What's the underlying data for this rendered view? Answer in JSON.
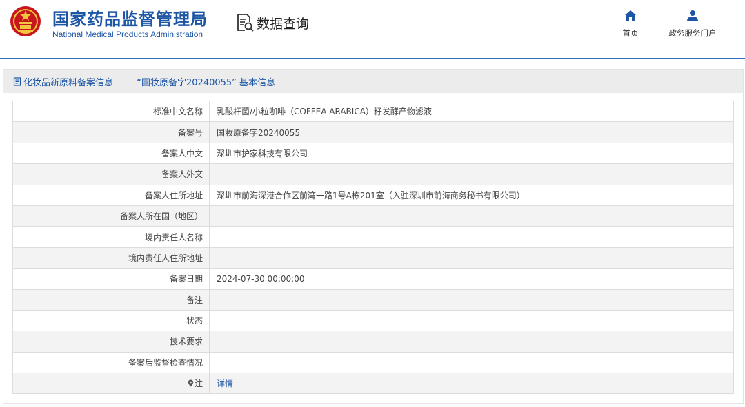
{
  "header": {
    "org_name_cn": "国家药品监督管理局",
    "org_name_en": "National Medical Products Administration",
    "section_title": "数据查询",
    "nav": [
      {
        "label": "首页",
        "icon": "home-icon"
      },
      {
        "label": "政务服务门户",
        "icon": "user-icon"
      }
    ]
  },
  "panel": {
    "title": "化妆品新原料备案信息 —— “国妆原备字20240055” 基本信息",
    "rows": [
      {
        "label": "标准中文名称",
        "value": "乳酸杆菌/小粒咖啡（COFFEA ARABICA）籽发酵产物滤液"
      },
      {
        "label": "备案号",
        "value": "国妆原备字20240055"
      },
      {
        "label": "备案人中文",
        "value": "深圳市护家科技有限公司"
      },
      {
        "label": "备案人外文",
        "value": ""
      },
      {
        "label": "备案人住所地址",
        "value": "深圳市前海深港合作区前湾一路1号A栋201室（入驻深圳市前海商务秘书有限公司）"
      },
      {
        "label": "备案人所在国（地区）",
        "value": ""
      },
      {
        "label": "境内责任人名称",
        "value": ""
      },
      {
        "label": "境内责任人住所地址",
        "value": ""
      },
      {
        "label": "备案日期",
        "value": "2024-07-30 00:00:00"
      },
      {
        "label": "备注",
        "value": ""
      },
      {
        "label": "状态",
        "value": ""
      },
      {
        "label": "技术要求",
        "value": ""
      },
      {
        "label": "备案后监督检查情况",
        "value": ""
      }
    ],
    "note_row": {
      "label": "注",
      "link_text": "详情"
    }
  },
  "colors": {
    "brand_blue": "#1d56a5",
    "header_rule": "#2f6fb6",
    "stripe": "#f3f3f3"
  }
}
